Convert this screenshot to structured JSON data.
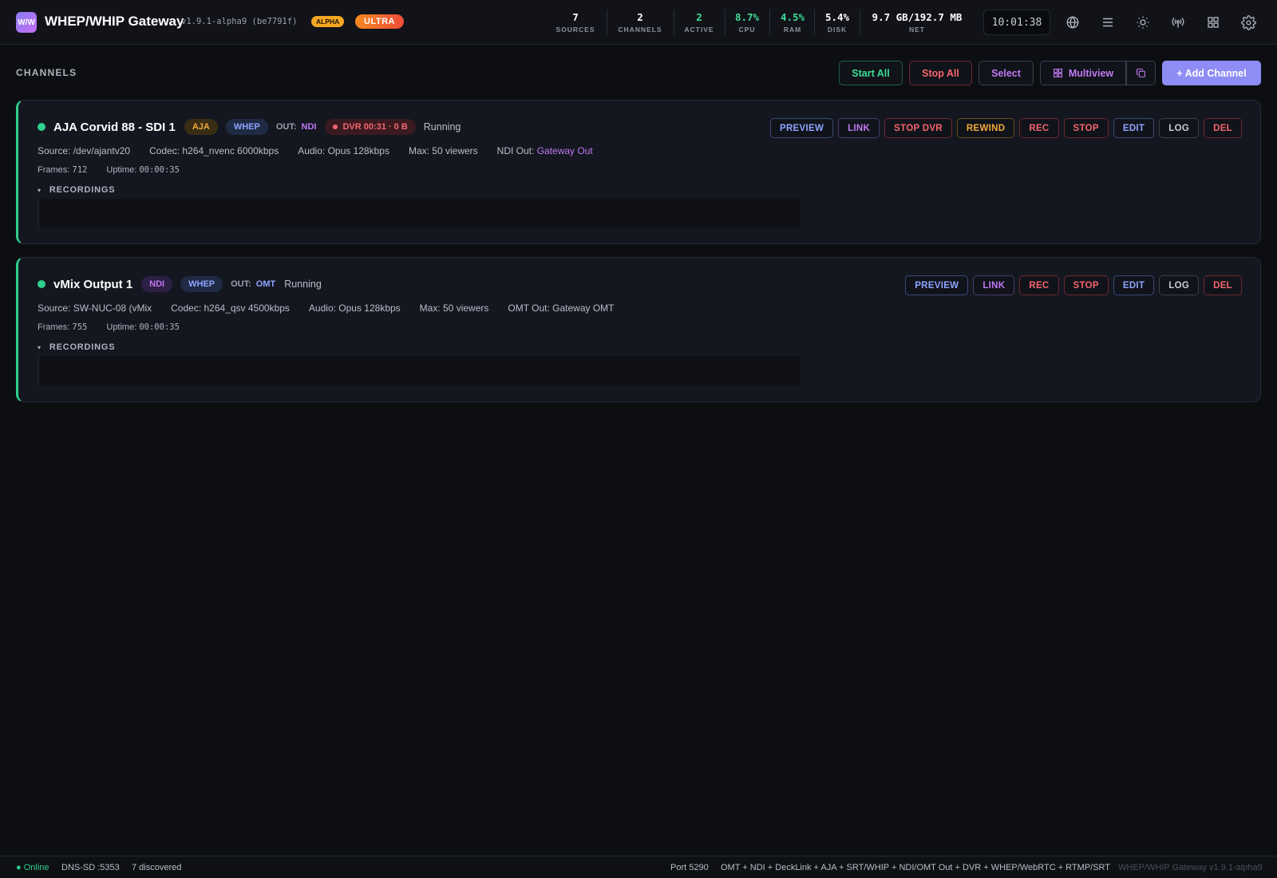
{
  "header": {
    "logo_text": "W/W",
    "title": "WHEP/WHIP Gateway",
    "version": "v1.9.1-alpha9 (be7791f)",
    "badge_alpha": "ALPHA",
    "badge_ultra": "ULTRA",
    "stats": [
      {
        "value": "7",
        "label": "SOURCES"
      },
      {
        "value": "2",
        "label": "CHANNELS"
      },
      {
        "value": "2",
        "label": "ACTIVE"
      },
      {
        "value": "8.7%",
        "label": "CPU"
      },
      {
        "value": "4.5%",
        "label": "RAM"
      },
      {
        "value": "5.4%",
        "label": "DISK"
      },
      {
        "value": "9.7 GB/192.7 MB",
        "label": "NET"
      }
    ],
    "clock": "10:01:38",
    "icons": [
      "globe-icon",
      "menu-icon",
      "sun-icon",
      "broadcast-icon",
      "grid-icon",
      "gear-icon"
    ]
  },
  "toolbar": {
    "section_title": "CHANNELS",
    "start_all": "Start All",
    "stop_all": "Stop All",
    "select": "Select",
    "multiview": "Multiview",
    "add_channel": "+ Add Channel"
  },
  "channels": [
    {
      "name": "AJA Corvid 88 - SDI 1",
      "input_badge": "AJA",
      "protocol_badge": "WHEP",
      "out_label": "OUT:",
      "out_value": "NDI",
      "dvr": "DVR 00:31 · 0 B",
      "status": "Running",
      "source": "Source: /dev/ajantv20",
      "codec": "Codec: h264_nvenc 6000kbps",
      "audio": "Audio: Opus 128kbps",
      "max": "Max: 50 viewers",
      "out_name_label": "NDI Out:",
      "out_name": "Gateway Out",
      "frames_label": "Frames:",
      "frames": "712",
      "uptime_label": "Uptime:",
      "uptime": "00:00:35",
      "recordings": "RECORDINGS",
      "actions": [
        "PREVIEW",
        "LINK",
        "STOP DVR",
        "REWIND",
        "REC",
        "STOP",
        "EDIT",
        "LOG",
        "DEL"
      ]
    },
    {
      "name": "vMix Output 1",
      "input_badge": "NDI",
      "protocol_badge": "WHEP",
      "out_label": "OUT:",
      "out_value": "OMT",
      "status": "Running",
      "source": "Source: SW-NUC-08 (vMix",
      "codec": "Codec: h264_qsv 4500kbps",
      "audio": "Audio: Opus 128kbps",
      "max": "Max: 50 viewers",
      "out_name": "OMT Out: Gateway OMT",
      "frames_label": "Frames:",
      "frames": "755",
      "uptime_label": "Uptime:",
      "uptime": "00:00:35",
      "recordings": "RECORDINGS",
      "actions": [
        "PREVIEW",
        "LINK",
        "REC",
        "STOP",
        "EDIT",
        "LOG",
        "DEL"
      ]
    }
  ],
  "footer": {
    "online": "● Online",
    "dns": "DNS-SD :5353",
    "discovered": "7 discovered",
    "port": "Port 5290",
    "features": "OMT + NDI + DeckLink + AJA + SRT/WHIP + NDI/OMT Out + DVR + WHEP/WebRTC + RTMP/SRT",
    "version": "WHEP/WHIP Gateway v1.9.1-alpha9"
  },
  "colors": {
    "accent_green": "#2fd08e",
    "accent_red": "#f5656d",
    "accent_purple": "#c079f2",
    "accent_blue": "#8fa4ff",
    "accent_amber": "#f2a93b",
    "add_button": "#8e8cf5"
  }
}
